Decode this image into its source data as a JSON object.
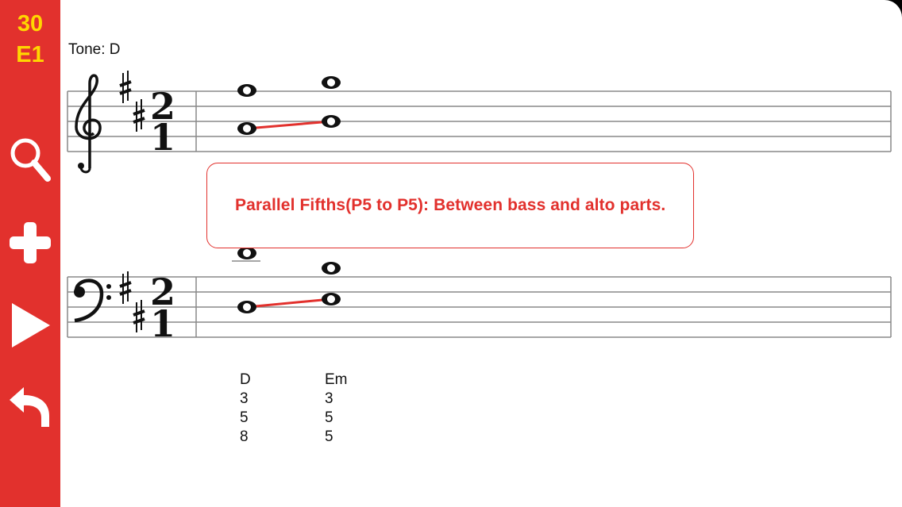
{
  "counter": {
    "top": "30",
    "bottom": "E1"
  },
  "sidebar": {
    "buttons": [
      {
        "name": "zoom-button",
        "icon": "magnifier-icon"
      },
      {
        "name": "add-button",
        "icon": "plus-icon"
      },
      {
        "name": "play-button",
        "icon": "play-icon"
      },
      {
        "name": "back-button",
        "icon": "undo-arrow-icon"
      }
    ]
  },
  "tone_label": "Tone: D",
  "time_signature": {
    "numerator": "2",
    "denominator": "1"
  },
  "message": "Parallel Fifths(P5 to P5): Between bass and alto parts.",
  "chords": [
    {
      "name": "D",
      "figures": [
        "3",
        "5",
        "8"
      ]
    },
    {
      "name": "Em",
      "figures": [
        "3",
        "5",
        "5"
      ]
    }
  ],
  "colors": {
    "accent": "#e2312d",
    "counter": "#ffd600",
    "error_line": "#e2312d"
  }
}
